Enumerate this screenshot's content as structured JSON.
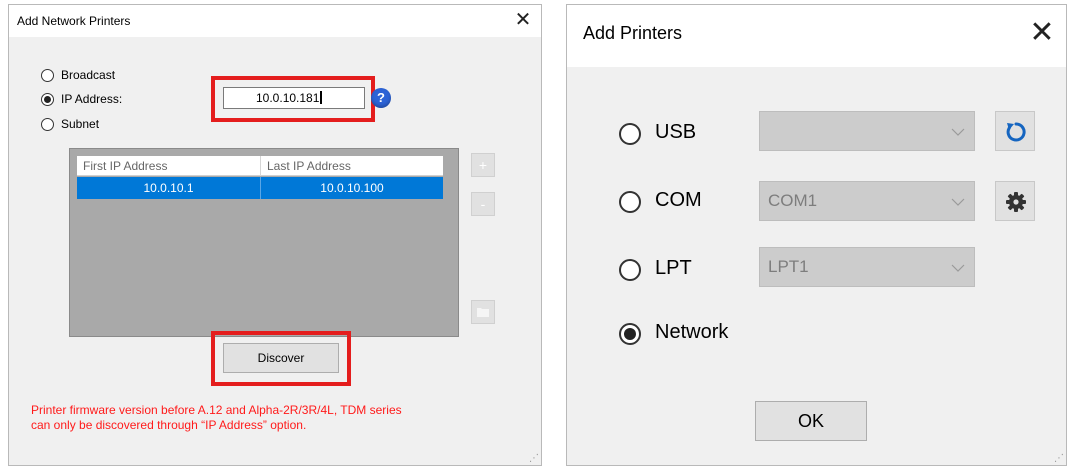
{
  "left_dialog": {
    "title": "Add Network Printers",
    "close_glyph": "✕",
    "options": [
      {
        "label": "Broadcast",
        "selected": false
      },
      {
        "label": "IP Address:",
        "selected": true
      },
      {
        "label": "Subnet",
        "selected": false
      }
    ],
    "ip_address_value": "10.0.10.181",
    "help_icon": "?",
    "table": {
      "columns": [
        "First IP Address",
        "Last IP Address"
      ],
      "rows": [
        [
          "10.0.10.1",
          "10.0.10.100"
        ]
      ]
    },
    "side_buttons": {
      "add": "+",
      "remove": "-",
      "folder": "folder-icon"
    },
    "discover_label": "Discover",
    "note_lines": [
      "Printer firmware version before A.12 and Alpha-2R/3R/4L, TDM series",
      "can only be discovered through “IP Address” option."
    ],
    "colors": {
      "highlight": "#e41d1d",
      "selection": "#0078d7",
      "note": "#ff1a1a"
    }
  },
  "right_dialog": {
    "title": "Add Printers",
    "close_glyph": "✕",
    "options": [
      {
        "label": "USB",
        "selected": false,
        "combo_value": "",
        "side_icon": "refresh-icon"
      },
      {
        "label": "COM",
        "selected": false,
        "combo_value": "COM1",
        "side_icon": "gear-icon"
      },
      {
        "label": "LPT",
        "selected": false,
        "combo_value": "LPT1"
      },
      {
        "label": "Network",
        "selected": true
      }
    ],
    "ok_label": "OK",
    "colors": {
      "refresh_icon": "#1565c0"
    }
  }
}
